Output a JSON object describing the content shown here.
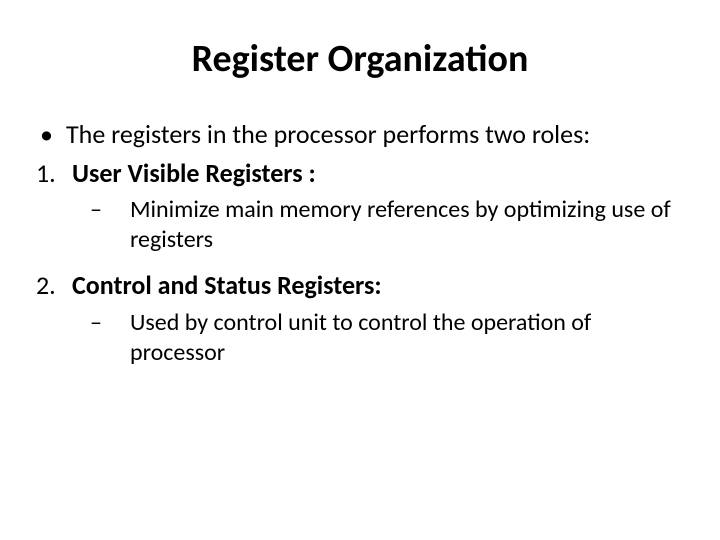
{
  "title": "Register Organization",
  "intro_bullet": "The registers in the processor performs two roles:",
  "items": [
    {
      "num": "1.",
      "label": "User Visible Registers :",
      "sub_dash": "–",
      "sub_text": "Minimize main memory references by optimizing use of registers"
    },
    {
      "num": "2.",
      "label": "Control and Status Registers:",
      "sub_dash": "–",
      "sub_text": "Used by control unit to control the operation of processor"
    }
  ],
  "bullet_glyph": "•"
}
